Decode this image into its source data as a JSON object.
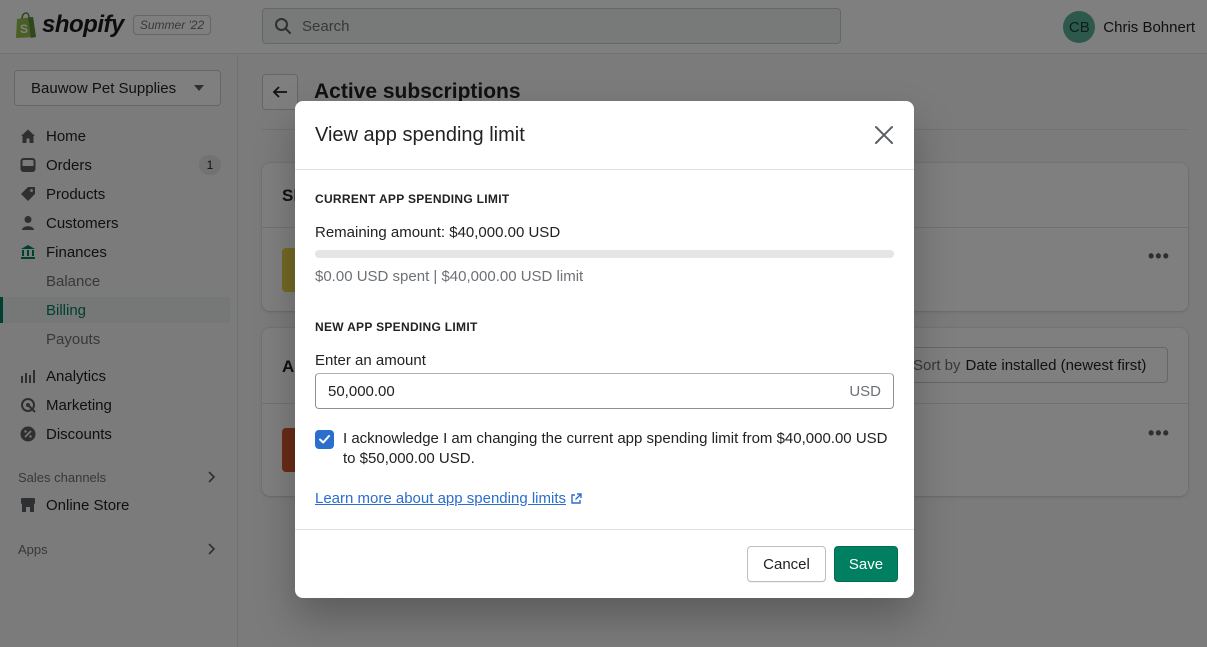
{
  "topbar": {
    "brand": "shopify",
    "edition": "Summer '22",
    "search_placeholder": "Search",
    "user_initials": "CB",
    "user_name": "Chris Bohnert"
  },
  "sidebar": {
    "store_name": "Bauwow Pet Supplies",
    "items": [
      {
        "label": "Home",
        "icon": "home-icon"
      },
      {
        "label": "Orders",
        "icon": "orders-icon",
        "badge": "1"
      },
      {
        "label": "Products",
        "icon": "tag-icon"
      },
      {
        "label": "Customers",
        "icon": "person-icon"
      },
      {
        "label": "Finances",
        "icon": "bank-icon"
      },
      {
        "label": "Balance"
      },
      {
        "label": "Billing",
        "active": true
      },
      {
        "label": "Payouts"
      },
      {
        "label": "Analytics",
        "icon": "bar-chart-icon"
      },
      {
        "label": "Marketing",
        "icon": "target-icon"
      },
      {
        "label": "Discounts",
        "icon": "discount-icon"
      }
    ],
    "sales_channels_title": "Sales channels",
    "online_store": "Online Store",
    "apps_title": "Apps"
  },
  "main": {
    "page_title": "Active subscriptions",
    "card1_head": "Sh",
    "card2_head": "Ap",
    "sort_by_label": "Sort by",
    "sort_by_value": "Date installed (newest first)",
    "more_actions": "•••"
  },
  "modal": {
    "title": "View app spending limit",
    "current_heading": "CURRENT APP SPENDING LIMIT",
    "remaining": "Remaining amount: $40,000.00 USD",
    "spent_fraction": 0,
    "spent_summary": "$0.00 USD spent | $40,000.00 USD limit",
    "new_heading": "NEW APP SPENDING LIMIT",
    "enter_amount_label": "Enter an amount",
    "amount_value": "50,000.00",
    "amount_suffix": "USD",
    "acknowledge_checked": true,
    "acknowledge_text": "I acknowledge I am changing the current app spending limit from $40,000.00 USD to $50,000.00 USD.",
    "learn_more": "Learn more about app spending limits",
    "cancel_label": "Cancel",
    "save_label": "Save"
  },
  "colors": {
    "primary_green": "#008060",
    "link_blue": "#2c6ecb",
    "avatar_green": "#5bb39b"
  }
}
